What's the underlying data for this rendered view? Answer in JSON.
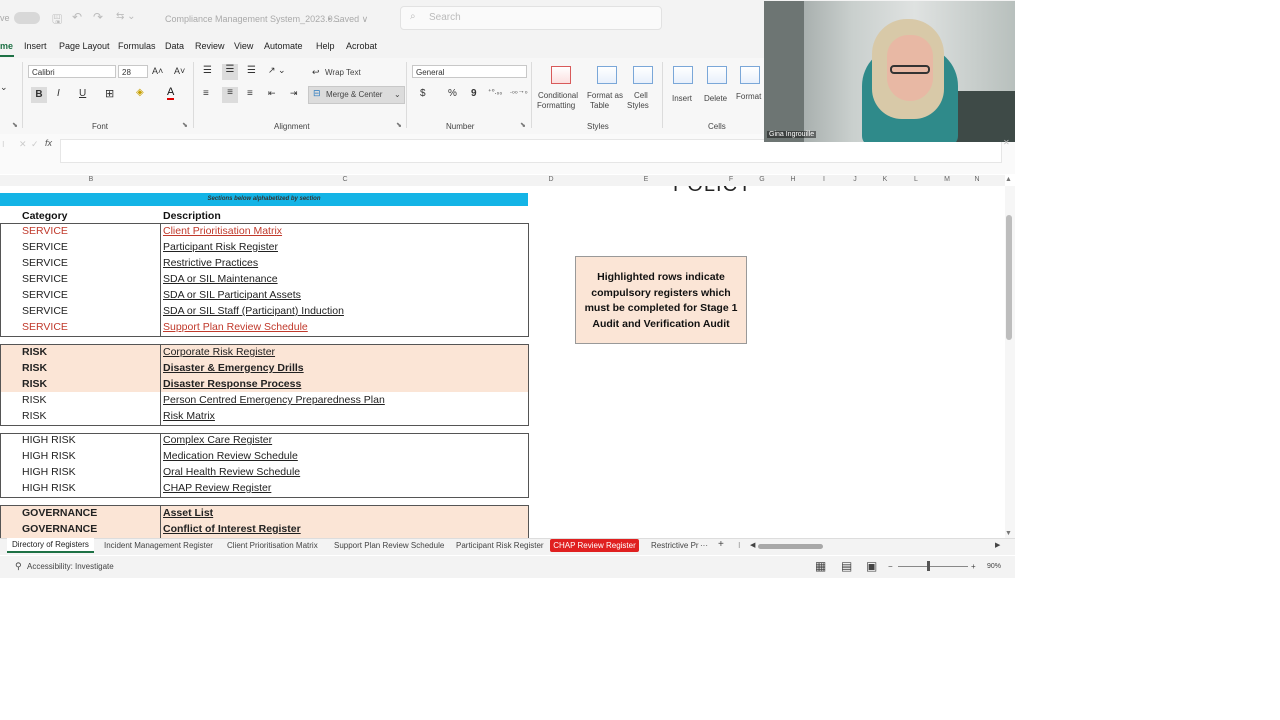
{
  "titlebar": {
    "autosave": "ve",
    "filename": "Compliance Management System_2023.0...",
    "saved": "• Saved ∨",
    "search_placeholder": "Search"
  },
  "menu": [
    "me",
    "Insert",
    "Page Layout",
    "Formulas",
    "Data",
    "Review",
    "View",
    "Automate",
    "Help",
    "Acrobat"
  ],
  "ribbon": {
    "font_name": "Calibri",
    "font_size": "28",
    "grow_font": "A˄",
    "shrink_font": "A˅",
    "bold": "B",
    "italic": "I",
    "underline": "U",
    "font_group": "Font",
    "wrap_text": "Wrap Text",
    "merge_center": "Merge & Center",
    "alignment_group": "Alignment",
    "number_format": "General",
    "currency": "$",
    "percent": "%",
    "comma": "9",
    "inc_decimal": "⁺⁰.₀₀",
    "dec_decimal": ".₀₀→₀",
    "number_group": "Number",
    "conditional_formatting_1": "Conditional",
    "conditional_formatting_2": "Formatting",
    "format_as_table_1": "Format as",
    "format_as_table_2": "Table",
    "cell_styles_1": "Cell",
    "cell_styles_2": "Styles",
    "styles_group": "Styles",
    "insert": "Insert",
    "delete": "Delete",
    "format": "Format",
    "cells_group": "Cells"
  },
  "formula_bar": {
    "fx": "fx"
  },
  "columns": [
    "B",
    "C",
    "D",
    "E",
    "F",
    "G",
    "H",
    "I",
    "J",
    "K",
    "L",
    "M",
    "N"
  ],
  "sheet": {
    "banner": "Sections below alphabetized by section",
    "policy_fragment": "POLICY",
    "header_category": "Category",
    "header_description": "Description",
    "note": "Highlighted rows indicate compulsory registers which must be completed for Stage 1 Audit and Verification Audit",
    "service_rows": [
      {
        "category": "SERVICE",
        "description": "Client Prioritisation Matrix"
      },
      {
        "category": "SERVICE",
        "description": "Participant Risk Register"
      },
      {
        "category": "SERVICE",
        "description": "Restrictive Practices"
      },
      {
        "category": "SERVICE",
        "description": "SDA or SIL Maintenance"
      },
      {
        "category": "SERVICE",
        "description": "SDA or SIL Participant Assets"
      },
      {
        "category": "SERVICE",
        "description": "SDA or SIL Staff (Participant) Induction"
      },
      {
        "category": "SERVICE",
        "description": "Support Plan Review Schedule"
      }
    ],
    "risk_rows": [
      {
        "category": "RISK",
        "description": "Corporate Risk Register"
      },
      {
        "category": "RISK",
        "description": "Disaster & Emergency Drills"
      },
      {
        "category": "RISK",
        "description": "Disaster Response Process"
      },
      {
        "category": "RISK",
        "description": "Person Centred Emergency Preparedness Plan"
      },
      {
        "category": "RISK",
        "description": "Risk Matrix"
      }
    ],
    "high_risk_rows": [
      {
        "category": "HIGH RISK",
        "description": "Complex Care Register"
      },
      {
        "category": "HIGH RISK",
        "description": "Medication Review Schedule"
      },
      {
        "category": "HIGH RISK",
        "description": "Oral Health Review Schedule"
      },
      {
        "category": "HIGH RISK",
        "description": "CHAP Review Register"
      }
    ],
    "governance_rows": [
      {
        "category": "GOVERNANCE",
        "description": "Asset List"
      },
      {
        "category": "GOVERNANCE",
        "description": "Conflict of Interest Register"
      }
    ]
  },
  "tabs": {
    "active": "Directory of Registers",
    "items": [
      "Incident Management Register",
      "Client Prioritisation Matrix",
      "Support Plan Review Schedule",
      "Participant Risk Register"
    ],
    "red_tab": "CHAP Review Register",
    "truncated": "Restrictive Pr",
    "more": "···",
    "add": "+"
  },
  "status": {
    "accessibility": "Accessibility: Investigate",
    "zoom": "90%",
    "minus": "−",
    "plus": "+"
  },
  "video": {
    "participant_name": "Gina Ingrouille"
  },
  "colors": {
    "banner": "#14b4e6",
    "highlight": "#fbe5d6",
    "red_text": "#c0392b",
    "red_tab": "#e02020"
  }
}
